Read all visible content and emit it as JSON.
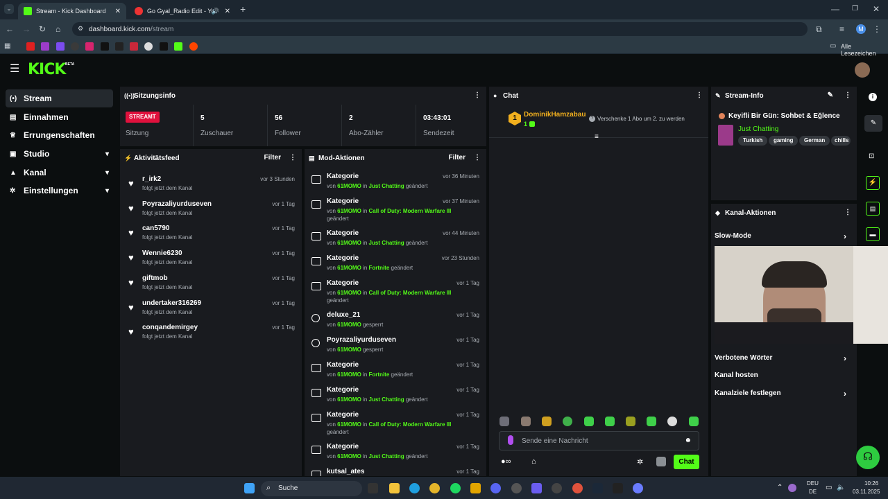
{
  "browser": {
    "tabs": [
      {
        "title": "Stream - Kick Dashboard"
      },
      {
        "title": "Go Gyal_Radio Edit - YouTube"
      }
    ],
    "url_host": "dashboard.kick.com",
    "url_path": "/stream",
    "bookmarks_all": "Alle Lesezeichen",
    "profile_initial": "M"
  },
  "app": {
    "logo": "KICK",
    "logo_badge": "BETA"
  },
  "sidebar": {
    "items": [
      {
        "label": "Stream"
      },
      {
        "label": "Einnahmen"
      },
      {
        "label": "Errungenschaften"
      },
      {
        "label": "Studio"
      },
      {
        "label": "Kanal"
      },
      {
        "label": "Einstellungen"
      }
    ]
  },
  "session": {
    "title": "Sitzungsinfo",
    "live_badge": "STREAMT",
    "live_label": "Sitzung",
    "stats": [
      {
        "value": "5",
        "label": "Zuschauer"
      },
      {
        "value": "56",
        "label": "Follower"
      },
      {
        "value": "2",
        "label": "Abo-Zähler"
      },
      {
        "value": "03:43:01",
        "label": "Sendezeit"
      }
    ]
  },
  "activity": {
    "title": "Aktivitätsfeed",
    "filter": "Filter",
    "rows": [
      {
        "name": "r_irk2",
        "sub": "folgt jetzt dem Kanal",
        "time": "vor 3 Stunden"
      },
      {
        "name": "Poyrazaliyurduseven",
        "sub": "folgt jetzt dem Kanal",
        "time": "vor 1 Tag"
      },
      {
        "name": "can5790",
        "sub": "folgt jetzt dem Kanal",
        "time": "vor 1 Tag"
      },
      {
        "name": "Wennie6230",
        "sub": "folgt jetzt dem Kanal",
        "time": "vor 1 Tag"
      },
      {
        "name": "giftmob",
        "sub": "folgt jetzt dem Kanal",
        "time": "vor 1 Tag"
      },
      {
        "name": "undertaker316269",
        "sub": "folgt jetzt dem Kanal",
        "time": "vor 1 Tag"
      },
      {
        "name": "conqandemirgey",
        "sub": "folgt jetzt dem Kanal",
        "time": "vor 1 Tag"
      }
    ]
  },
  "mod": {
    "title": "Mod-Aktionen",
    "filter": "Filter",
    "rows": [
      {
        "title": "Kategorie",
        "time": "vor 36 Minuten",
        "von": "von",
        "user": "61MOMO",
        "in": "in",
        "target": "Just Chatting",
        "action": "geändert"
      },
      {
        "title": "Kategorie",
        "time": "vor 37 Minuten",
        "von": "von",
        "user": "61MOMO",
        "in": "in",
        "target": "Call of Duty: Modern Warfare III",
        "action": "geändert"
      },
      {
        "title": "Kategorie",
        "time": "vor 44 Minuten",
        "von": "von",
        "user": "61MOMO",
        "in": "in",
        "target": "Just Chatting",
        "action": "geändert"
      },
      {
        "title": "Kategorie",
        "time": "vor 23 Stunden",
        "von": "von",
        "user": "61MOMO",
        "in": "in",
        "target": "Fortnite",
        "action": "geändert"
      },
      {
        "title": "Kategorie",
        "time": "vor 1 Tag",
        "von": "von",
        "user": "61MOMO",
        "in": "in",
        "target": "Call of Duty: Modern Warfare III",
        "action": "geändert"
      },
      {
        "title": "deluxe_21",
        "time": "vor 1 Tag",
        "von": "von",
        "user": "61MOMO",
        "in": "",
        "target": "",
        "action": "gesperrt"
      },
      {
        "title": "Poyrazaliyurduseven",
        "time": "vor 1 Tag",
        "von": "von",
        "user": "61MOMO",
        "in": "",
        "target": "",
        "action": "gesperrt"
      },
      {
        "title": "Kategorie",
        "time": "vor 1 Tag",
        "von": "von",
        "user": "61MOMO",
        "in": "in",
        "target": "Fortnite",
        "action": "geändert"
      },
      {
        "title": "Kategorie",
        "time": "vor 1 Tag",
        "von": "von",
        "user": "61MOMO",
        "in": "in",
        "target": "Just Chatting",
        "action": "geändert"
      },
      {
        "title": "Kategorie",
        "time": "vor 1 Tag",
        "von": "von",
        "user": "61MOMO",
        "in": "in",
        "target": "Call of Duty: Modern Warfare III",
        "action": "geändert"
      },
      {
        "title": "Kategorie",
        "time": "vor 1 Tag",
        "von": "von",
        "user": "61MOMO",
        "in": "in",
        "target": "Just Chatting",
        "action": "geändert"
      },
      {
        "title": "kutsal_ates",
        "time": "vor 1 Tag",
        "von": "",
        "user": "",
        "in": "",
        "target": "",
        "action": ""
      }
    ]
  },
  "chat": {
    "title": "Chat",
    "pinned_rank": "1",
    "pinned_user": "DominikHamzabau",
    "pinned_count": "1",
    "pinned_text": "Verschenke 1 Abo um 2. zu werden",
    "placeholder": "Sende eine Nachricht",
    "send": "Chat"
  },
  "stream_info": {
    "title": "Stream-Info",
    "stream_title": "Keyifli Bir Gün: Sohbet & Eğlence",
    "category": "Just Chatting",
    "tags": [
      "Turkish",
      "gaming",
      "German",
      "chills"
    ]
  },
  "kanal_aktionen": {
    "title": "Kanal-Aktionen",
    "items": [
      {
        "label": "Slow-Mode"
      },
      {
        "label": "Verbotene Wörter"
      },
      {
        "label": "Kanal hosten"
      },
      {
        "label": "Kanalziele festlegen"
      }
    ]
  },
  "taskbar": {
    "search": "Suche",
    "lang_top": "DEU",
    "lang_bottom": "DE",
    "time": "10:26",
    "date": "03.11.2025"
  },
  "colors": {
    "accent": "#53fc18",
    "live": "#e0113d",
    "panel": "#191b1f"
  }
}
